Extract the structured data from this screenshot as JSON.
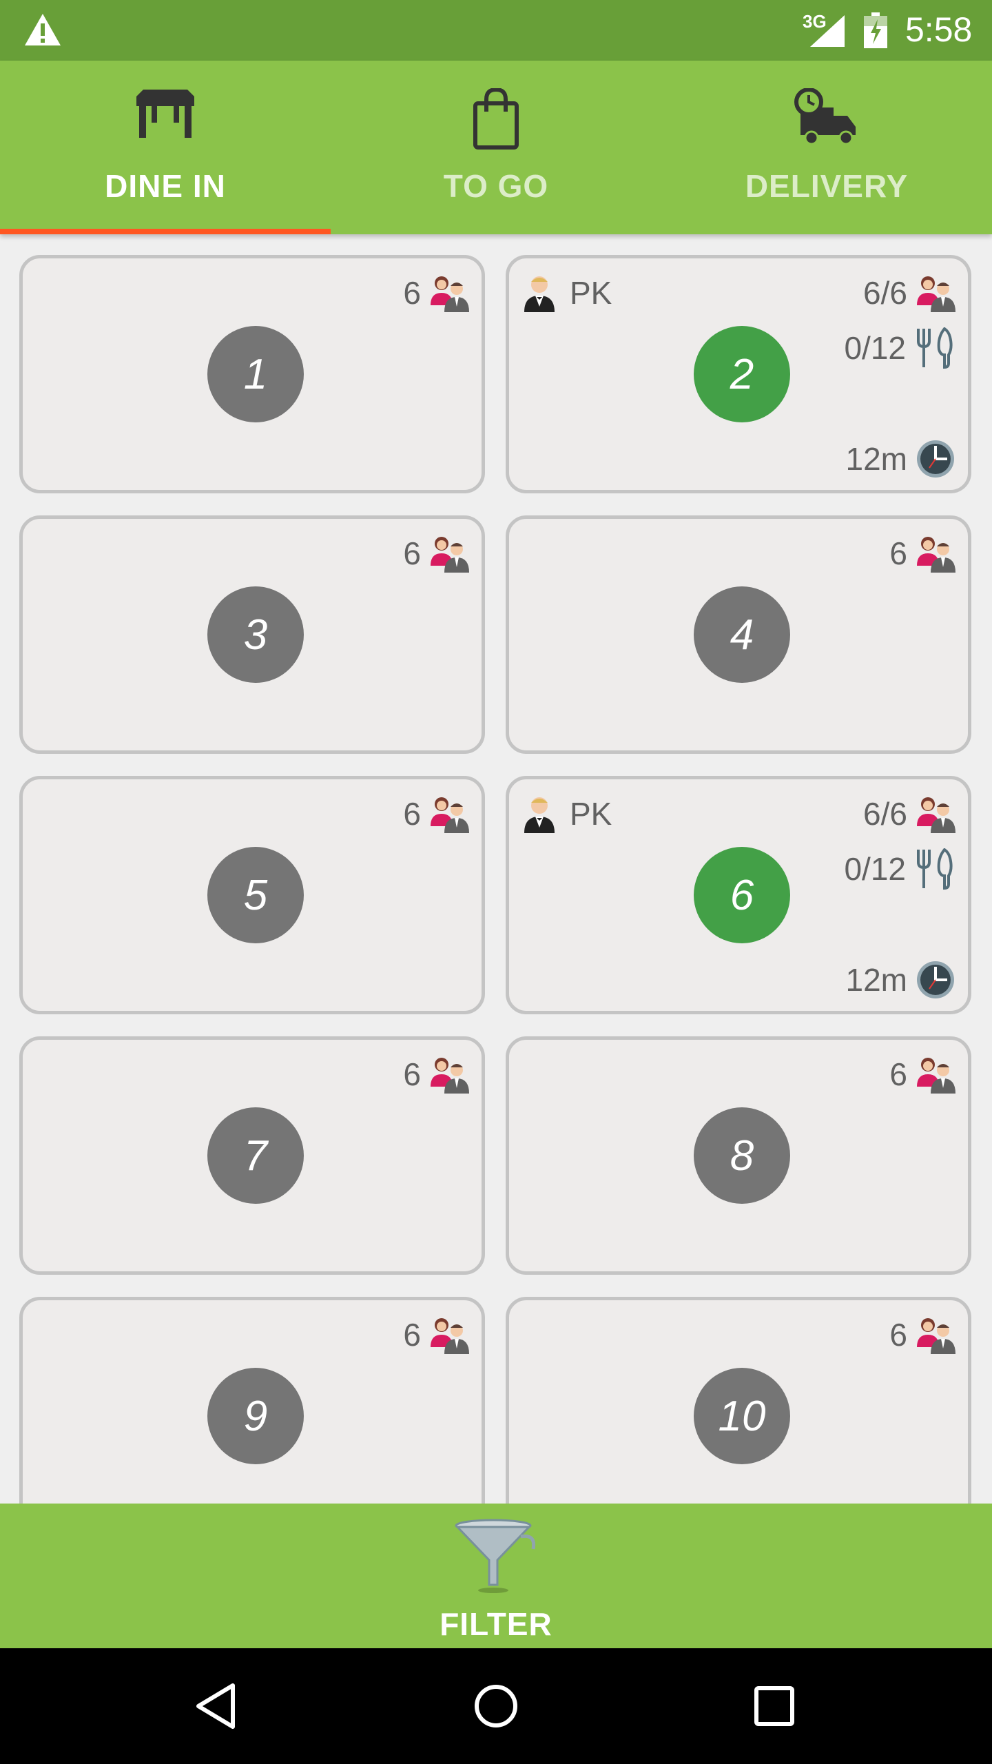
{
  "status_bar": {
    "network": "3G",
    "time": "5:58"
  },
  "tabs": [
    {
      "label": "DINE IN",
      "icon": "table-icon",
      "active": true
    },
    {
      "label": "TO GO",
      "icon": "shopping-bag-icon",
      "active": false
    },
    {
      "label": "DELIVERY",
      "icon": "delivery-truck-icon",
      "active": false
    }
  ],
  "tables": [
    {
      "number": "1",
      "seats": "6",
      "status": "free"
    },
    {
      "number": "2",
      "seats": "6/6",
      "status": "occupied",
      "waiter": "PK",
      "covers": "0/12",
      "elapsed": "12m"
    },
    {
      "number": "3",
      "seats": "6",
      "status": "free"
    },
    {
      "number": "4",
      "seats": "6",
      "status": "free"
    },
    {
      "number": "5",
      "seats": "6",
      "status": "free"
    },
    {
      "number": "6",
      "seats": "6/6",
      "status": "occupied",
      "waiter": "PK",
      "covers": "0/12",
      "elapsed": "12m"
    },
    {
      "number": "7",
      "seats": "6",
      "status": "free"
    },
    {
      "number": "8",
      "seats": "6",
      "status": "free"
    },
    {
      "number": "9",
      "seats": "6",
      "status": "free"
    },
    {
      "number": "10",
      "seats": "6",
      "status": "free"
    }
  ],
  "filter": {
    "label": "FILTER",
    "icon": "funnel-icon"
  },
  "colors": {
    "primary": "#8bc34a",
    "primary_dark": "#689f38",
    "accent": "#ff5722",
    "occupied": "#43a047",
    "free": "#757575"
  }
}
